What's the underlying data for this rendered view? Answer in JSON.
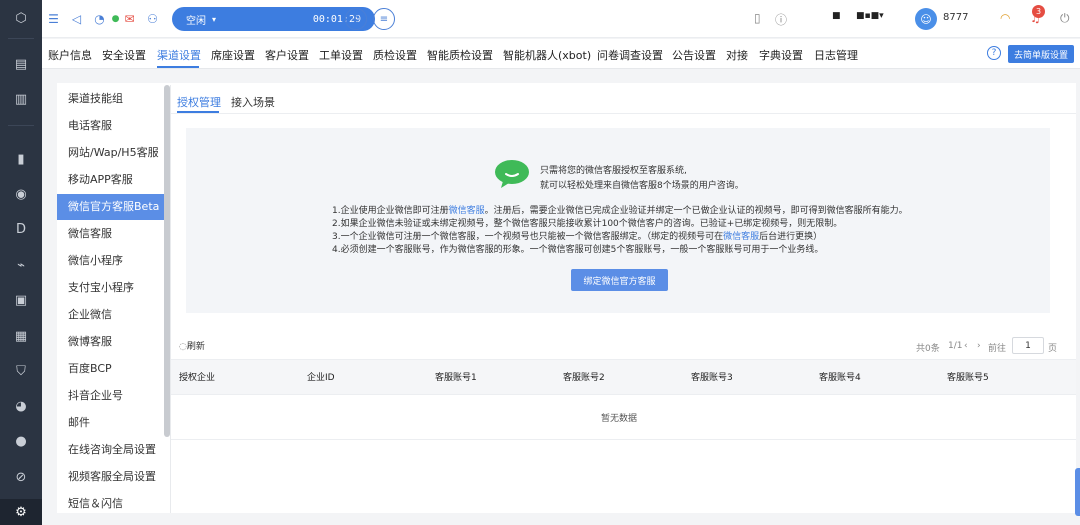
{
  "topbar": {
    "status_label": "空闲",
    "timer": "00:01:29",
    "agent_id": "8777",
    "notification_count": "3"
  },
  "nav": {
    "tabs": [
      "账户信息",
      "安全设置",
      "渠道设置",
      "席座设置",
      "客户设置",
      "工单设置",
      "质检设置",
      "智能质检设置",
      "智能机器人(xbot)",
      "问卷调查设置",
      "公告设置",
      "对接",
      "字典设置",
      "日志管理"
    ],
    "active_tab": "渠道设置",
    "help": "?",
    "simple_version": "去简单版设置"
  },
  "sidebar": {
    "items": [
      "渠道技能组",
      "电话客服",
      "网站/Wap/H5客服",
      "移动APP客服",
      "微信官方客服Beta",
      "微信客服",
      "微信小程序",
      "支付宝小程序",
      "企业微信",
      "微博客服",
      "百度BCP",
      "抖音企业号",
      "邮件",
      "在线咨询全局设置",
      "视频客服全局设置",
      "短信＆闪信"
    ],
    "active": "微信官方客服Beta"
  },
  "tabs": {
    "auth": "授权管理",
    "scene": "接入场景"
  },
  "info": {
    "intro1": "只需将您的微信客服授权至客服系统,",
    "intro2": "就可以轻松处理来自微信客服8个场景的用户咨询。",
    "rule1_a": "1.企业使用企业微信即可注册",
    "rule1_link": "微信客服",
    "rule1_b": "。注册后，需要企业微信已完成企业验证并绑定一个已做企业认证的视频号，即可得到微信客服所有能力。",
    "rule2": "2.如果企业微信未验证或未绑定视频号，整个微信客服只能接收累计100个微信客户的咨询。已验证+已绑定视频号，则无限制。",
    "rule3_a": "3.一个企业微信可注册一个微信客服，一个视频号也只能被一个微信客服绑定。（绑定的视频号可在",
    "rule3_link": "微信客服",
    "rule3_b": "后台进行更换）",
    "rule4": "4.必须创建一个客服账号，作为微信客服的形象。一个微信客服可创建5个客服账号，一般一个客服账号可用于一个业务线。",
    "bind_button": "绑定微信官方客服"
  },
  "list": {
    "refresh": "刷新",
    "total": "共0条",
    "page": "1/1",
    "goto": "前往",
    "page_input": "1",
    "page_unit": "页",
    "columns": [
      "授权企业",
      "企业ID",
      "客服账号1",
      "客服账号2",
      "客服账号3",
      "客服账号4",
      "客服账号5"
    ],
    "empty": "暂无数据"
  },
  "colors": {
    "accent": "#3d7de0",
    "rail": "#2b3442",
    "wechat_green": "#3fba58"
  }
}
